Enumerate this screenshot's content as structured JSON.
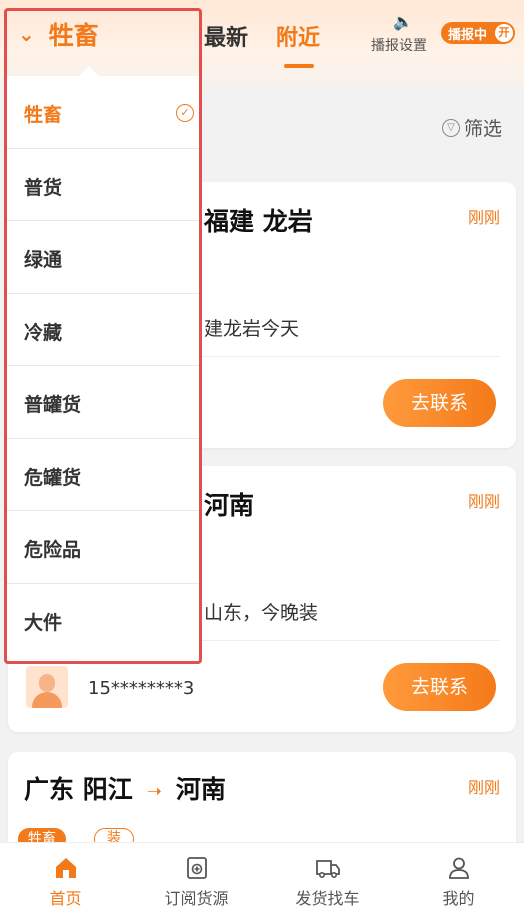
{
  "header": {
    "category": "牲畜",
    "tabs": [
      {
        "label": "最新"
      },
      {
        "label": "附近"
      }
    ],
    "broadcast": {
      "label": "播报设置",
      "toggle_text": "播报中",
      "toggle_state": "开"
    }
  },
  "filter_label": "筛选",
  "cards": [
    {
      "route_visible": "福建 龙岩",
      "time": "刚刚",
      "desc_visible": "建龙岩今天",
      "contact_label": "去联系"
    },
    {
      "route_visible": "河南",
      "time": "刚刚",
      "desc_visible": "山东，今晚装",
      "phone": "15********3",
      "contact_label": "去联系"
    },
    {
      "origin": "广东 阳江",
      "destination": "河南",
      "time": "刚刚",
      "tags": [
        "牲畜",
        "装"
      ]
    }
  ],
  "dropdown": {
    "selected": "牲畜",
    "items": [
      {
        "label": "牲畜"
      },
      {
        "label": "普货"
      },
      {
        "label": "绿通"
      },
      {
        "label": "冷藏"
      },
      {
        "label": "普罐货"
      },
      {
        "label": "危罐货"
      },
      {
        "label": "危险品"
      },
      {
        "label": "大件"
      }
    ]
  },
  "bottom_nav": [
    {
      "label": "首页",
      "icon": "home-icon"
    },
    {
      "label": "订阅货源",
      "icon": "subscribe-icon"
    },
    {
      "label": "发货找车",
      "icon": "truck-icon"
    },
    {
      "label": "我的",
      "icon": "user-icon"
    }
  ],
  "colors": {
    "accent": "#f27a1a",
    "highlight_border": "#e0504f"
  }
}
